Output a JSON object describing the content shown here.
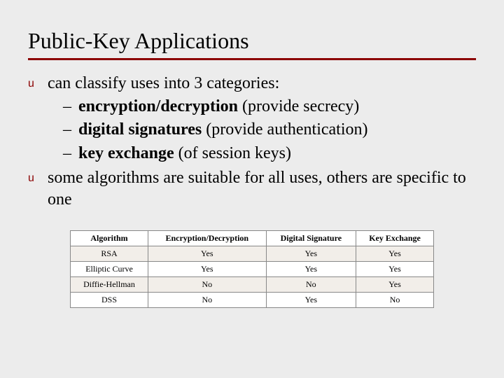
{
  "title": "Public-Key Applications",
  "bullet_glyph": "u",
  "dash_glyph": "–",
  "body": {
    "item1": "can classify uses into 3 categories:",
    "sub1_bold": "encryption/decryption",
    "sub1_rest": " (provide secrecy)",
    "sub2_bold": "digital signatures",
    "sub2_rest": " (provide authentication)",
    "sub3_bold": "key exchange",
    "sub3_rest": " (of session keys)",
    "item2": "some algorithms are suitable for all uses, others are specific to one"
  },
  "chart_data": {
    "type": "table",
    "title": "",
    "columns": [
      "Algorithm",
      "Encryption/Decryption",
      "Digital Signature",
      "Key Exchange"
    ],
    "rows": [
      [
        "RSA",
        "Yes",
        "Yes",
        "Yes"
      ],
      [
        "Elliptic Curve",
        "Yes",
        "Yes",
        "Yes"
      ],
      [
        "Diffie-Hellman",
        "No",
        "No",
        "Yes"
      ],
      [
        "DSS",
        "No",
        "Yes",
        "No"
      ]
    ]
  }
}
